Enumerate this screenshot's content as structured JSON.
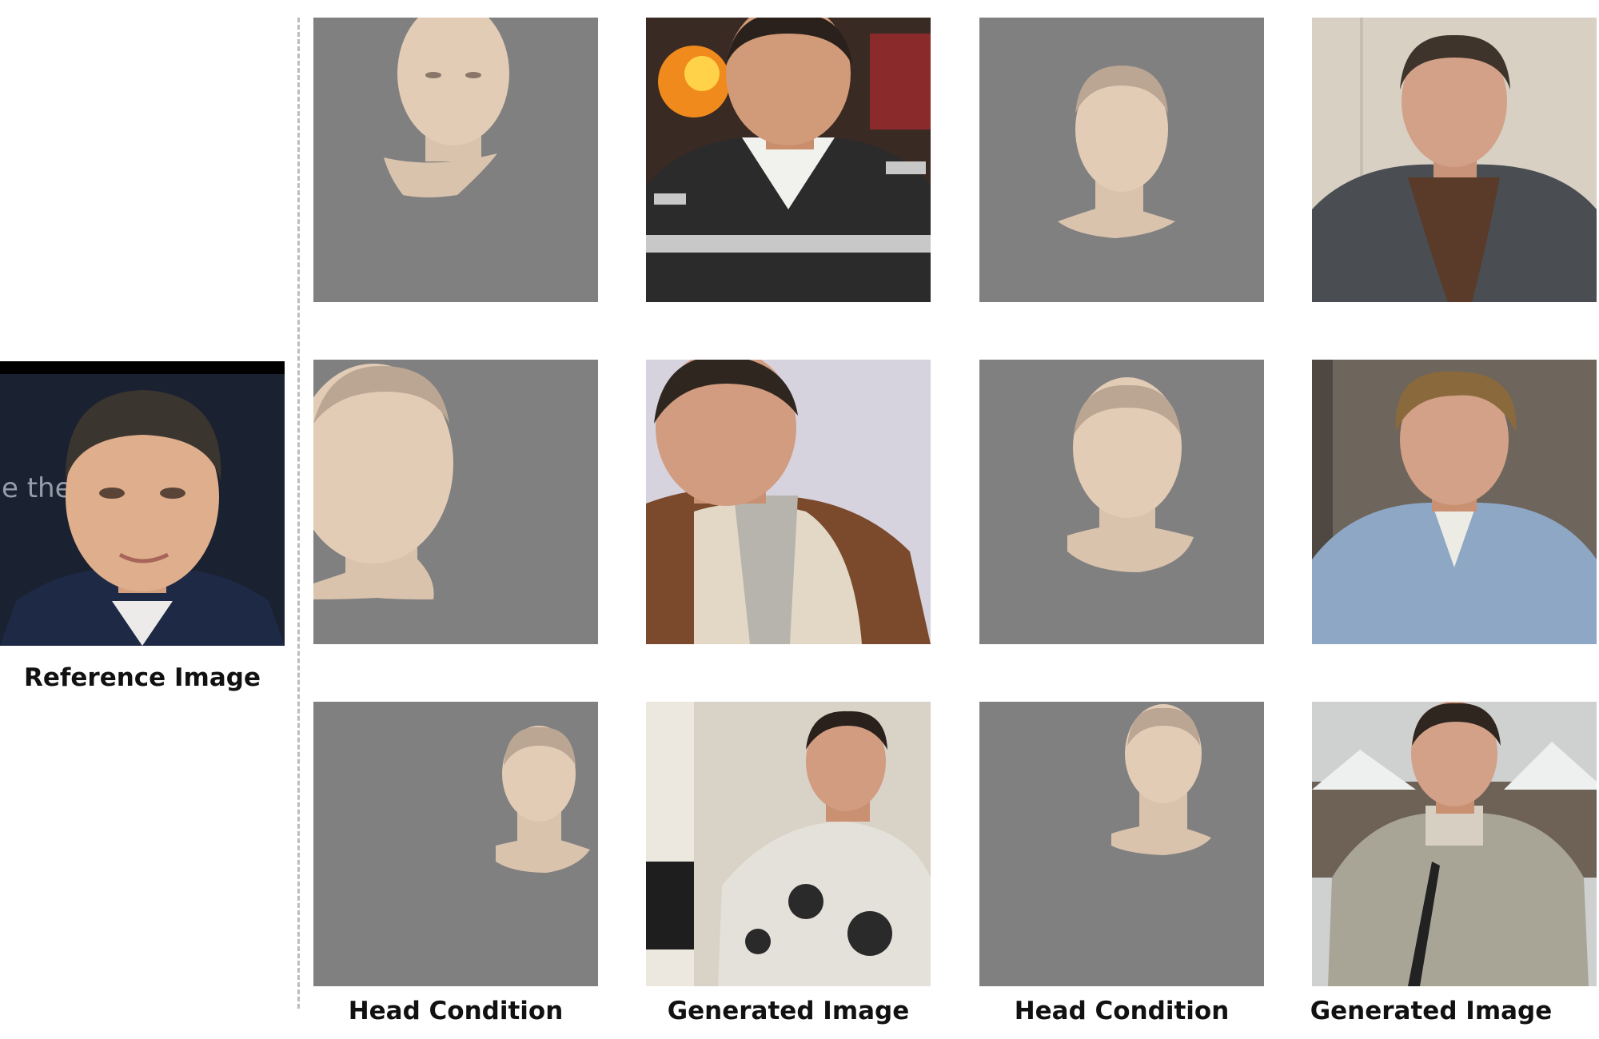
{
  "captions": {
    "reference": "Reference Image",
    "col1": "Head Condition",
    "col2": "Generated Image",
    "col3": "Head Condition",
    "col4": "Generated Image"
  },
  "colors": {
    "condition_bg": "#808080",
    "divider": "#bdbdbd",
    "skin": "#d9c3ad"
  },
  "reference_backdrop_text": "e the -YP",
  "rows": [
    {
      "condition_a": "head-front-top",
      "generated_a": "man-dark-jacket-fire",
      "condition_b": "head-small-center",
      "generated_b": "man-patterned-coat-scarf"
    },
    {
      "condition_a": "head-left-large",
      "generated_a": "man-brown-jacket",
      "condition_b": "head-center",
      "generated_b": "man-striped-shirt"
    },
    {
      "condition_a": "head-right-small",
      "generated_a": "man-stained-sweater",
      "condition_b": "head-right-center",
      "generated_b": "man-grey-coat-snow"
    }
  ]
}
